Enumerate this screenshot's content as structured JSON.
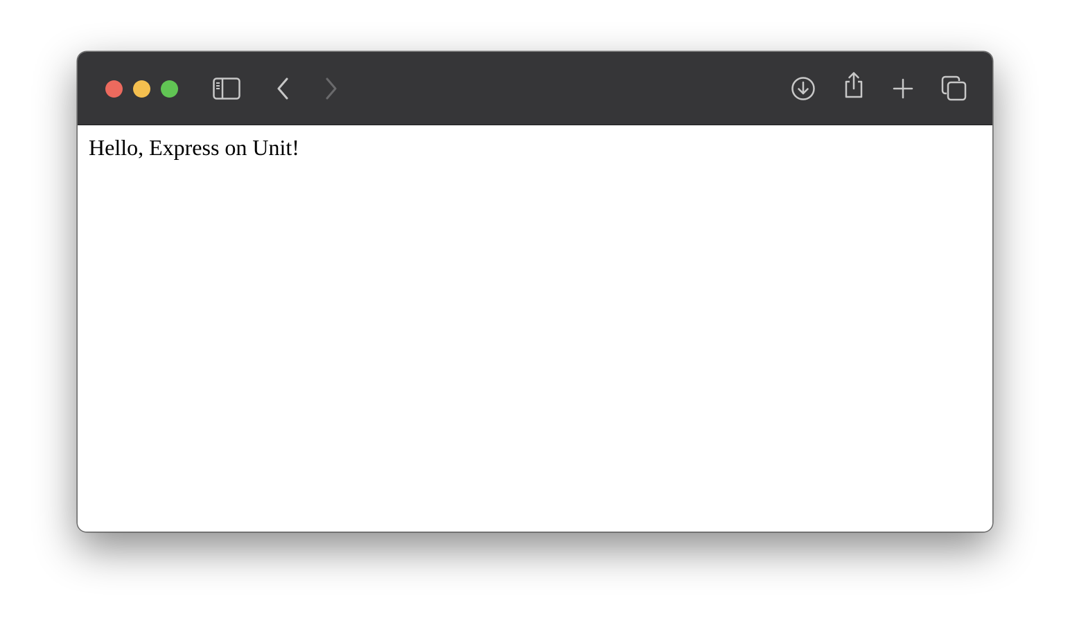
{
  "window": {
    "traffic_lights": {
      "close_color": "#ec6a5e",
      "minimize_color": "#f4bf4f",
      "zoom_color": "#61c554"
    },
    "toolbar": {
      "background": "#363638",
      "icons": {
        "sidebar": "sidebar-icon",
        "back": "chevron-left-icon",
        "forward": "chevron-right-icon",
        "downloads": "download-icon",
        "share": "share-icon",
        "new_tab": "plus-icon",
        "tab_overview": "tabs-overview-icon"
      },
      "forward_enabled": false
    }
  },
  "page": {
    "body_text": "Hello, Express on Unit!"
  }
}
